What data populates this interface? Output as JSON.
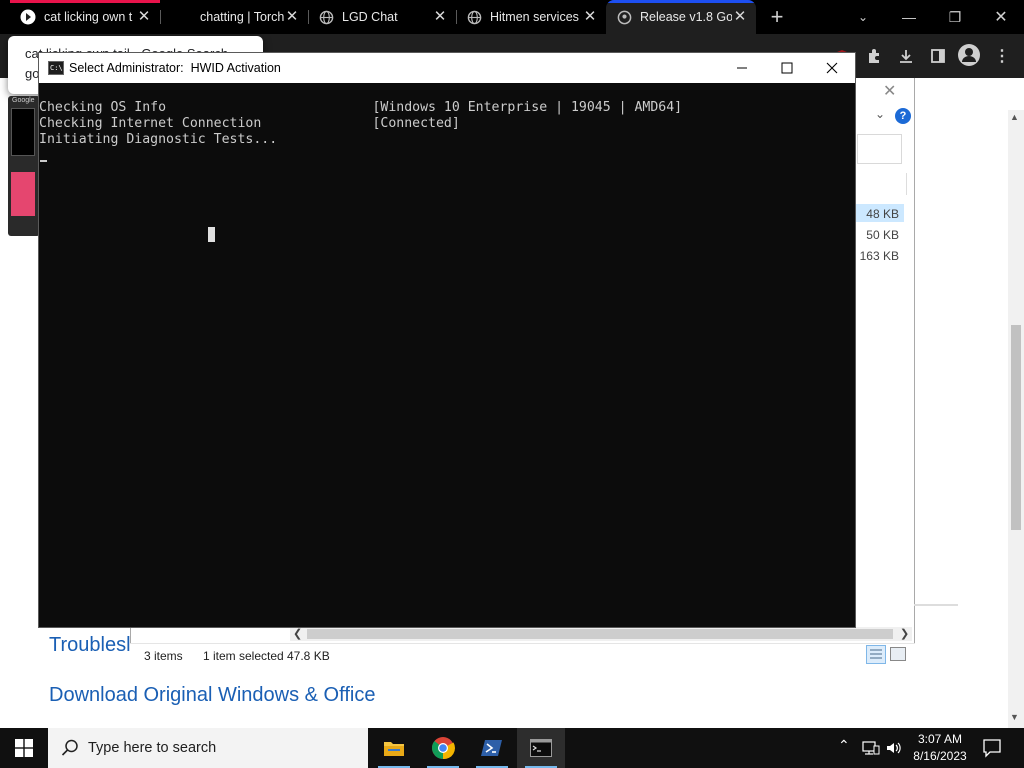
{
  "browser": {
    "tabs": [
      {
        "title": "cat licking own t",
        "icon": "google-icon",
        "active": false,
        "accent": "#e8134b"
      },
      {
        "title": "chatting | Torch!",
        "icon": "blank-page-icon",
        "active": false
      },
      {
        "title": "LGD Chat",
        "icon": "globe-icon",
        "active": false
      },
      {
        "title": "Hitmen services",
        "icon": "globe-icon",
        "active": false
      },
      {
        "title": "Release v1.8 Go",
        "icon": "github-icon",
        "active": true,
        "accent": "#1d4ff2"
      }
    ],
    "new_tab_label": "+",
    "search_popup": {
      "line1": "cat licking own tail - Google Search",
      "line2": "go"
    },
    "thumb_label": "Google"
  },
  "explorer": {
    "sizes": [
      "48 KB",
      "50 KB",
      "163 KB"
    ],
    "status_items": "3 items",
    "status_selected": "1 item selected",
    "status_size": "47.8 KB"
  },
  "page": {
    "link1": "Troublesl",
    "link2": "Download Original Windows & Office"
  },
  "console": {
    "title": "Select Administrator:  HWID Activation",
    "icon_text": "C:\\",
    "lines": [
      "Checking OS Info                          [Windows 10 Enterprise | 19045 | AMD64]",
      "Checking Internet Connection              [Connected]",
      "Initiating Diagnostic Tests..."
    ]
  },
  "taskbar": {
    "search_placeholder": "Type here to search",
    "time": "3:07 AM",
    "date": "8/16/2023",
    "apps": [
      "file-explorer-icon",
      "chrome-icon",
      "powershell-icon",
      "terminal-icon"
    ]
  },
  "colors": {
    "console_bg": "#0c0c0c",
    "console_text": "#cccccc",
    "link": "#1a5fb4",
    "taskbar": "#101010"
  }
}
